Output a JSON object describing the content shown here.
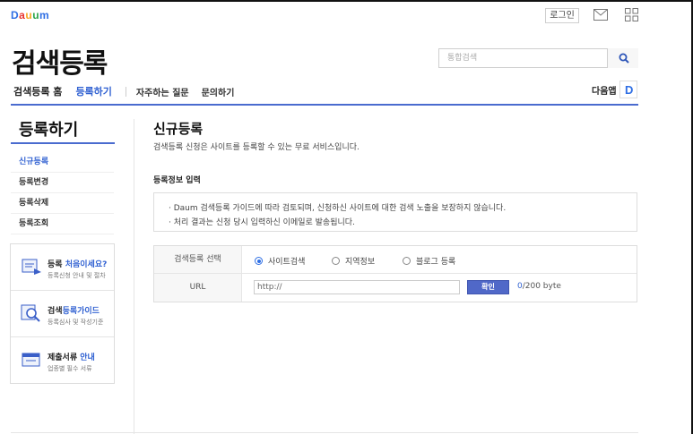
{
  "header": {
    "logo": [
      "D",
      "a",
      "u",
      "u",
      "m"
    ],
    "login_label": "로그인",
    "page_title": "검색등록",
    "search_placeholder": "통합검색"
  },
  "nav": {
    "home": "검색등록 홈",
    "register": "등록하기",
    "faq": "자주하는 질문",
    "inquiry": "문의하기",
    "daum_app": "다음앱",
    "daum_app_letter": "D"
  },
  "sidebar": {
    "title": "등록하기",
    "items": [
      {
        "label": "신규등록"
      },
      {
        "label": "등록변경"
      },
      {
        "label": "등록삭제"
      },
      {
        "label": "등록조회"
      }
    ],
    "banners": [
      {
        "title_a": "등록 ",
        "title_b": "처음이세요?",
        "sub": "등록신청 안내 및 절차"
      },
      {
        "title_a": "검색",
        "title_b": "등록가이드",
        "sub": "등록심사 및 작성기준"
      },
      {
        "title_a": "제출서류 ",
        "title_b": "안내",
        "sub": "업종별 필수 서류"
      }
    ]
  },
  "main": {
    "title": "신규등록",
    "desc": "검색등록 신청은 사이트를 등록할 수 있는 무료 서비스입니다.",
    "section_title": "등록정보 입력",
    "notice": [
      "· Daum 검색등록 가이드에 따라 검토되며, 신청하신 사이트에 대한 검색 노출을 보장하지 않습니다.",
      "· 처리 결과는 신청 당시 입력하신 이메일로 발송됩니다."
    ],
    "form": {
      "type_label": "검색등록 선택",
      "options": [
        "사이트검색",
        "지역정보",
        "블로그 등록"
      ],
      "selected": "사이트검색",
      "url_label": "URL",
      "url_value": "http://",
      "confirm_label": "확인",
      "byte_used": "0",
      "byte_max": "/200 byte"
    }
  },
  "colors": {
    "accent": "#3061d2",
    "nav_line": "#4a6bcf",
    "button": "#5068c8"
  }
}
